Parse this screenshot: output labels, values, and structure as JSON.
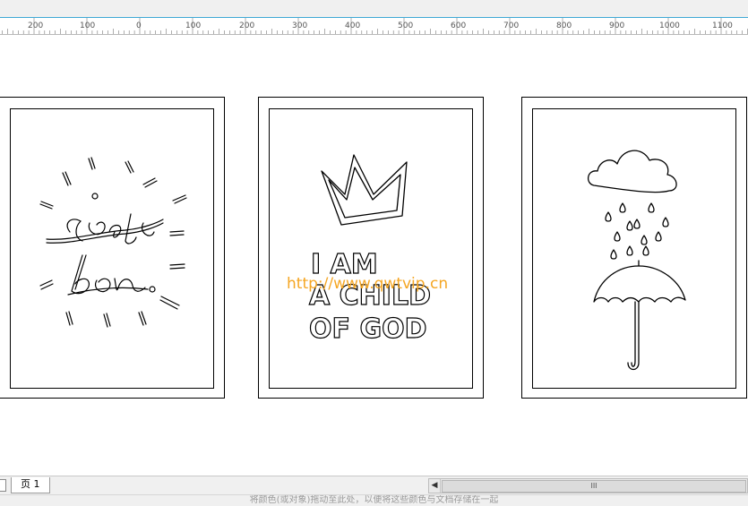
{
  "ruler": {
    "labels": [
      "200",
      "100",
      "0",
      "100",
      "200",
      "300",
      "400",
      "500",
      "600",
      "700",
      "800",
      "900",
      "1000",
      "1100"
    ]
  },
  "canvas": {
    "watermark": "http://www.qwtvip.cn",
    "card_middle_text": [
      "I AM",
      "A CHILD",
      "OF GOD"
    ],
    "card_left_text": [
      "c'est",
      "bon."
    ]
  },
  "statusbar": {
    "page_tab": "页 1",
    "scroll_thumb_grip": "III"
  },
  "hint": "将颜色(或对象)拖动至此处，以便将这些颜色与文档存储在一起"
}
